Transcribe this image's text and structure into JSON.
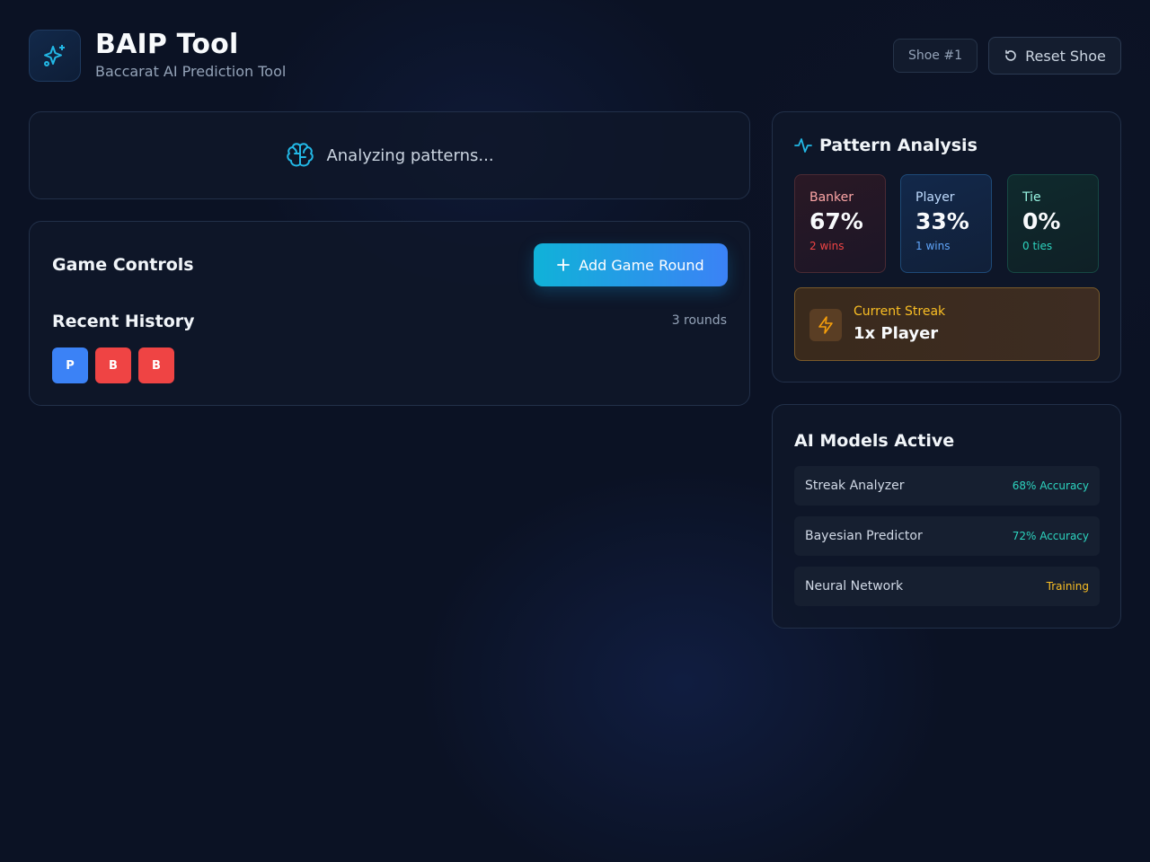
{
  "header": {
    "title": "BAIP Tool",
    "subtitle": "Baccarat AI Prediction Tool",
    "logo_icon": "sparkles-icon",
    "shoe_badge": "Shoe #1",
    "reset_label": "Reset Shoe"
  },
  "analyzing": {
    "icon": "brain-icon",
    "text": "Analyzing patterns..."
  },
  "controls": {
    "title": "Game Controls",
    "add_label": "Add Game Round",
    "history_title": "Recent History",
    "rounds_count": "3 rounds",
    "history": [
      "P",
      "B",
      "B"
    ]
  },
  "pattern": {
    "title": "Pattern Analysis",
    "banker": {
      "label": "Banker",
      "value": "67%",
      "sub": "2 wins"
    },
    "player": {
      "label": "Player",
      "value": "33%",
      "sub": "1 wins"
    },
    "tie": {
      "label": "Tie",
      "value": "0%",
      "sub": "0 ties"
    },
    "streak": {
      "label": "Current Streak",
      "value": "1x Player"
    }
  },
  "models": {
    "title": "AI Models Active",
    "items": [
      {
        "name": "Streak Analyzer",
        "status": "68% Accuracy"
      },
      {
        "name": "Bayesian Predictor",
        "status": "72% Accuracy"
      },
      {
        "name": "Neural Network",
        "status": "Training"
      }
    ]
  },
  "colors": {
    "accent": "#0ea5e9",
    "banker": "#ef4444",
    "player": "#3b82f6",
    "tie": "#2dd4bf",
    "streak": "#fbbf24"
  }
}
